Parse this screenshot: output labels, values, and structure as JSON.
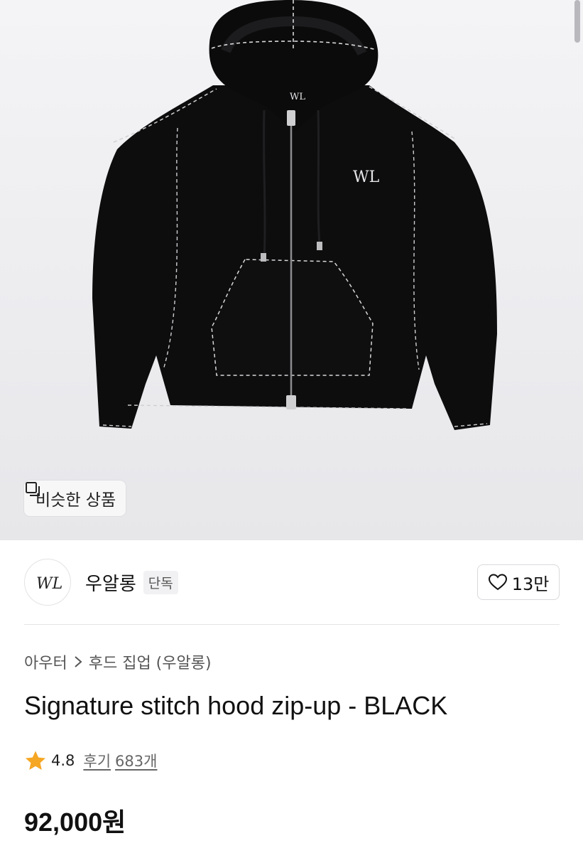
{
  "hero": {
    "image_alt": "black zip-up hoodie with white contrast stitching",
    "similar_button": {
      "icon": "similar-products-icon",
      "label": "비슷한 상품"
    }
  },
  "brand": {
    "logo_text": "WL",
    "name": "우알롱",
    "badge": "단독",
    "like": {
      "icon": "heart-icon",
      "count": "13만"
    }
  },
  "breadcrumb": {
    "category": "아우터",
    "separator_icon": "chevron-right-icon",
    "subcategory": "후드 집업 (우알롱)"
  },
  "product": {
    "title": "Signature stitch hood zip-up - BLACK",
    "rating": {
      "icon": "star-icon",
      "score": "4.8",
      "review_label": "후기",
      "review_count": "683개"
    },
    "price": "92,000원"
  },
  "colors": {
    "star": "#f5a623",
    "text": "#111111",
    "muted": "#666666",
    "hero_bg": "#ececef"
  }
}
